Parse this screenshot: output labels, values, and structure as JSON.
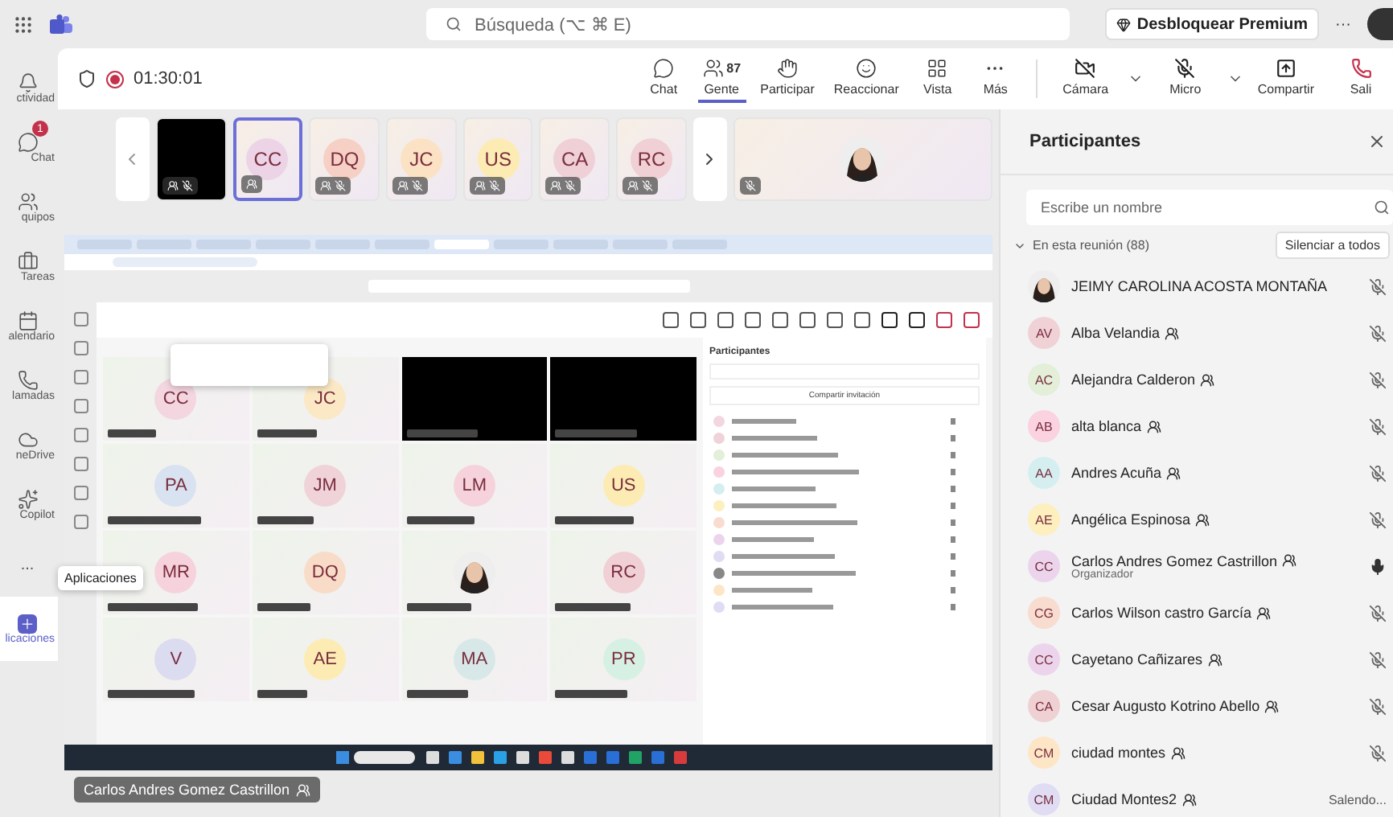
{
  "top_bar": {
    "search": {
      "placeholder": "Búsqueda (⌥ ⌘ E)"
    },
    "premium_button": "Desbloquear Premium",
    "more": "···"
  },
  "sidebar": {
    "items": [
      {
        "label": "ctividad",
        "kind": "bell",
        "selected": false
      },
      {
        "label": "Chat",
        "kind": "chat",
        "selected": false,
        "badge": "1"
      },
      {
        "label": "quipos",
        "kind": "teams",
        "selected": false
      },
      {
        "label": "Tareas",
        "kind": "tasks",
        "selected": false
      },
      {
        "label": "alendario",
        "kind": "calendar",
        "selected": false
      },
      {
        "label": "lamadas",
        "kind": "calls",
        "selected": false
      },
      {
        "label": "neDrive",
        "kind": "cloud",
        "selected": false
      },
      {
        "label": "Copilot",
        "kind": "copilot",
        "selected": false
      },
      {
        "label": "...",
        "kind": "more",
        "selected": false
      },
      {
        "label": "licaciones",
        "kind": "apps",
        "selected": true
      }
    ],
    "tooltip": "Aplicaciones"
  },
  "meeting_bar": {
    "timer": "01:30:01",
    "recording": true,
    "actions": [
      {
        "label": "Chat",
        "kind": "chat",
        "selected": false
      },
      {
        "label": "Gente",
        "kind": "people",
        "selected": true,
        "count": "87"
      },
      {
        "label": "Participar",
        "kind": "hand",
        "selected": false
      },
      {
        "label": "Reaccionar",
        "kind": "smile",
        "selected": false
      },
      {
        "label": "Vista",
        "kind": "grid",
        "selected": false
      },
      {
        "label": "Más",
        "kind": "more",
        "selected": false
      }
    ],
    "controls": [
      {
        "label": "Cámara",
        "kind": "camera_off",
        "dropdown": true
      },
      {
        "label": "Micro",
        "kind": "mic_off",
        "dropdown": true
      },
      {
        "label": "Compartir",
        "kind": "share",
        "dropdown": false
      },
      {
        "label": "Sali",
        "kind": "leave",
        "dropdown": false
      }
    ]
  },
  "filmstrip": [
    {
      "kind": "video_off",
      "selected": false,
      "guest": true,
      "muted": true
    },
    {
      "kind": "avatar",
      "initials": "CC",
      "color": "#ecd3e6",
      "selected": true,
      "guest": true,
      "muted": false
    },
    {
      "kind": "avatar",
      "initials": "DQ",
      "color": "#f6d0c4",
      "selected": false,
      "guest": true,
      "muted": true
    },
    {
      "kind": "avatar",
      "initials": "JC",
      "color": "#fbe2c4",
      "selected": false,
      "guest": true,
      "muted": true
    },
    {
      "kind": "avatar",
      "initials": "US",
      "color": "#fcecb4",
      "selected": false,
      "guest": true,
      "muted": true
    },
    {
      "kind": "avatar",
      "initials": "CA",
      "color": "#efd0d6",
      "selected": false,
      "guest": true,
      "muted": true
    },
    {
      "kind": "avatar",
      "initials": "RC",
      "color": "#f0d0d4",
      "selected": false,
      "guest": true,
      "muted": true
    },
    {
      "kind": "picture",
      "selected": false,
      "guest": false,
      "muted": true
    }
  ],
  "shared_screen": {
    "grid": [
      {
        "kind": "avatar",
        "initials": "CC",
        "color": "#f3d6e0"
      },
      {
        "kind": "avatar",
        "initials": "JC",
        "color": "#fbe8c4"
      },
      {
        "kind": "video_off"
      },
      {
        "kind": "video_off"
      },
      {
        "kind": "avatar",
        "initials": "PA",
        "color": "#d8e2f0"
      },
      {
        "kind": "avatar",
        "initials": "JM",
        "color": "#efd3d8"
      },
      {
        "kind": "avatar",
        "initials": "LM",
        "color": "#f6d3dc"
      },
      {
        "kind": "avatar",
        "initials": "US",
        "color": "#fcecb4"
      },
      {
        "kind": "avatar",
        "initials": "MR",
        "color": "#f6d3dc"
      },
      {
        "kind": "avatar",
        "initials": "DQ",
        "color": "#f8dcc8"
      },
      {
        "kind": "picture"
      },
      {
        "kind": "avatar",
        "initials": "RC",
        "color": "#f0d0d4"
      },
      {
        "kind": "avatar",
        "initials": "V",
        "color": "#dcdcf0"
      },
      {
        "kind": "avatar",
        "initials": "AE",
        "color": "#fcecb4"
      },
      {
        "kind": "avatar",
        "initials": "MA",
        "color": "#d8e8e8"
      },
      {
        "kind": "avatar",
        "initials": "PR",
        "color": "#d6f0e4"
      }
    ],
    "panel": {
      "title": "Participantes",
      "invite": "Compartir invitación"
    }
  },
  "presenter": "Carlos Andres Gomez Castrillon",
  "participants": {
    "title": "Participantes",
    "search": {
      "placeholder": "Escribe un nombre"
    },
    "section": {
      "label": "En esta reunión (88)",
      "expanded": true
    },
    "mute_all": "Silenciar a todos",
    "people": [
      {
        "name": "JEIMY CAROLINA ACOSTA MONTAÑA",
        "kind": "picture",
        "guest": false,
        "muted": true
      },
      {
        "name": "Alba Velandia",
        "initials": "AV",
        "color": "#f0d2d6",
        "guest": true,
        "muted": true
      },
      {
        "name": "Alejandra Calderon",
        "initials": "AC",
        "color": "#e3efd9",
        "guest": true,
        "muted": true
      },
      {
        "name": "alta blanca",
        "initials": "AB",
        "color": "#fad2e0",
        "guest": true,
        "muted": true
      },
      {
        "name": "Andres Acuña",
        "initials": "AA",
        "color": "#d5eff1",
        "guest": true,
        "muted": true
      },
      {
        "name": "Angélica Espinosa",
        "initials": "AE",
        "color": "#fdefbe",
        "guest": true,
        "muted": true
      },
      {
        "name": "Carlos Andres Gomez Castrillon",
        "initials": "CC",
        "color": "#ecd5ec",
        "guest": true,
        "muted": false,
        "role": "Organizador"
      },
      {
        "name": "Carlos Wilson castro García",
        "initials": "CG",
        "color": "#f8dccf",
        "guest": true,
        "muted": true
      },
      {
        "name": "Cayetano Cañizares",
        "initials": "CC",
        "color": "#ecd5ec",
        "guest": true,
        "muted": true
      },
      {
        "name": "Cesar Augusto Kotrino Abello",
        "initials": "CA",
        "color": "#efd0d3",
        "guest": true,
        "muted": true
      },
      {
        "name": "ciudad montes",
        "initials": "CM",
        "color": "#fde6c6",
        "guest": true,
        "muted": true
      },
      {
        "name": "Ciudad Montes2",
        "initials": "CM",
        "color": "#dfdcf4",
        "guest": true,
        "status": "Salendo..."
      }
    ]
  }
}
